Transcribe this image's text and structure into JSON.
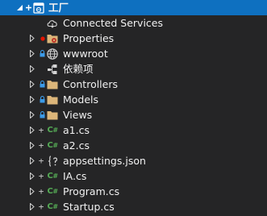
{
  "tree": {
    "project": {
      "label": "工厂",
      "selected": true,
      "expanded": true
    },
    "items": [
      {
        "label": "Connected Services",
        "icon": "connected-services-icon",
        "expandable": false
      },
      {
        "label": "Properties",
        "icon": "properties-folder-icon",
        "expandable": true,
        "badge": "red-dot"
      },
      {
        "label": "wwwroot",
        "icon": "globe-icon",
        "expandable": true,
        "badge": "lock"
      },
      {
        "label": "依赖项",
        "icon": "dependencies-icon",
        "expandable": true
      },
      {
        "label": "Controllers",
        "icon": "folder-icon",
        "expandable": true,
        "badge": "lock"
      },
      {
        "label": "Models",
        "icon": "folder-icon",
        "expandable": true,
        "badge": "lock"
      },
      {
        "label": "Views",
        "icon": "folder-icon",
        "expandable": true,
        "badge": "lock"
      },
      {
        "label": "a1.cs",
        "icon": "csharp-file-icon",
        "expandable": true,
        "status": "+"
      },
      {
        "label": "a2.cs",
        "icon": "csharp-file-icon",
        "expandable": true,
        "status": "+"
      },
      {
        "label": "appsettings.json",
        "icon": "json-file-icon",
        "expandable": true,
        "status": "+"
      },
      {
        "label": "IA.cs",
        "icon": "csharp-file-icon",
        "expandable": true,
        "status": "+"
      },
      {
        "label": "Program.cs",
        "icon": "csharp-file-icon",
        "expandable": true,
        "status": "+"
      },
      {
        "label": "Startup.cs",
        "icon": "csharp-file-icon",
        "expandable": true,
        "status": "+"
      }
    ],
    "icon_text": {
      "cs": "C",
      "cs_hash": "#"
    }
  },
  "colors": {
    "background": "#252526",
    "selection": "#0e70c0",
    "folder": "#dcb67a",
    "csharp": "#55aa55",
    "lock": "#3c9be8",
    "badge_red": "#e51400"
  }
}
